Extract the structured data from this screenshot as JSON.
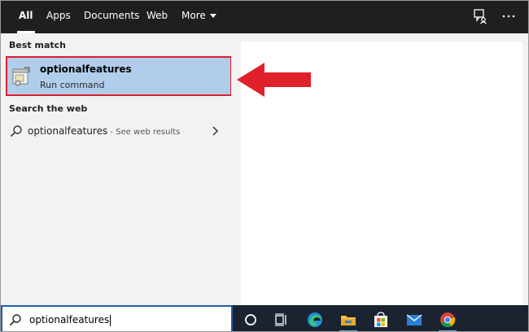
{
  "tabs": [
    {
      "label": "All",
      "active": true
    },
    {
      "label": "Apps",
      "active": false
    },
    {
      "label": "Documents",
      "active": false
    },
    {
      "label": "Web",
      "active": false
    },
    {
      "label": "More",
      "active": false
    }
  ],
  "top_icons": [
    "feedback-icon",
    "more-options-icon"
  ],
  "results": {
    "best_match_label": "Best match",
    "best_match": {
      "title": "optionalfeatures",
      "subtitle": "Run command",
      "icon": "run-command-icon"
    },
    "search_web_label": "Search the web",
    "web_result": {
      "query": "optionalfeatures",
      "suffix": " - See web results",
      "icon": "search-icon"
    }
  },
  "search": {
    "value": "optionalfeatures"
  },
  "taskbar_icons": [
    "cortana-icon",
    "task-view-icon",
    "edge-icon",
    "file-explorer-icon",
    "store-icon",
    "mail-icon",
    "chrome-icon"
  ],
  "colors": {
    "highlight": "#b1cdec",
    "annotation_red": "#e0202a",
    "taskbar": "#1b2330",
    "topbar": "#1f1f1f"
  }
}
